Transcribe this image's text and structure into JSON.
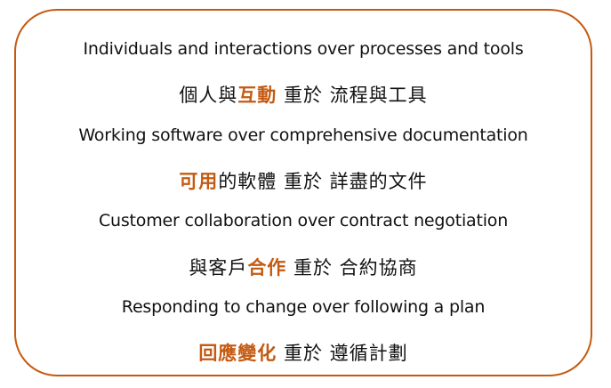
{
  "frame": {
    "border_color": "#c55a11"
  },
  "values": [
    {
      "english": "Individuals and interactions over processes and tools",
      "chinese": {
        "before": "個人與",
        "emphasis": "互動",
        "after": " 重於 流程與工具"
      }
    },
    {
      "english": "Working software over comprehensive documentation",
      "chinese": {
        "before": "",
        "emphasis": "可用",
        "after": "的軟體 重於 詳盡的文件"
      }
    },
    {
      "english": "Customer collaboration over contract negotiation",
      "chinese": {
        "before": "與客戶",
        "emphasis": "合作",
        "after": " 重於 合約協商"
      }
    },
    {
      "english": "Responding to change over following a plan",
      "chinese": {
        "before": "",
        "emphasis": "回應變化",
        "after": " 重於 遵循計劃"
      }
    }
  ]
}
